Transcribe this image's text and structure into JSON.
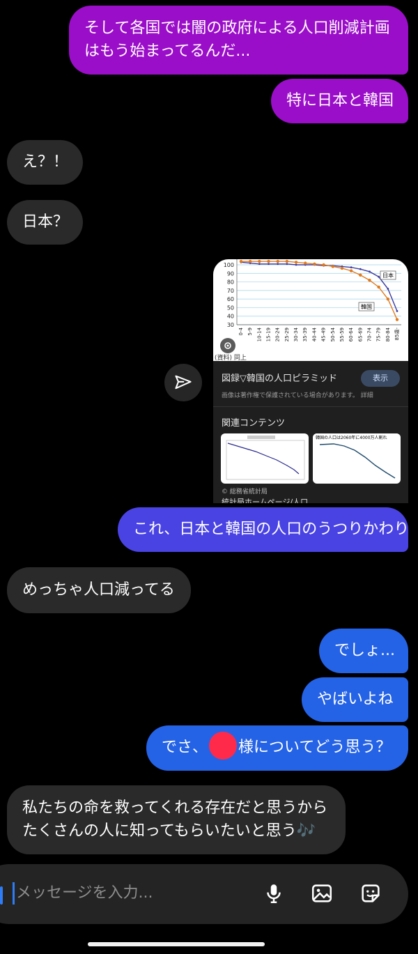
{
  "messages": {
    "m1_line1": "そして各国では闇の政府による人口削減計画",
    "m1_line2": "はもう始まってるんだ...",
    "m2": "特に日本と韓国",
    "m3": "え？！",
    "m4": "日本？",
    "m5": "これ、日本と韓国の人口のうつりかわり",
    "m6": "めっちゃ人口減ってる",
    "m7": "でしょ...",
    "m8": "やばいよね",
    "m9_before": "でさ、",
    "m9_after": "様についてどう思う？",
    "m10_line1": "私たちの命を救ってくれる存在だと思うから",
    "m10_line2": "たくさんの人に知ってもらいたいと思う🎶"
  },
  "card": {
    "title": "図録▽韓国の人口ピラミッド",
    "show_button": "表示",
    "copyright_note": "画像は著作権で保護されている場合があります。 詳細",
    "related": "関連コンテンツ",
    "source": "© 総務省統計局",
    "caption": "統計局ホームページ/人口...",
    "chart_source_label": "(資料) 同上",
    "legend_japan": "日本",
    "legend_korea": "韓国",
    "thumb2_title": "韓国の人口は2060年に4000万人割れ"
  },
  "chart_data": {
    "type": "line",
    "categories": [
      "0-4",
      "5-9",
      "10-14",
      "15-19",
      "20-24",
      "25-29",
      "30-34",
      "35-39",
      "40-44",
      "45-49",
      "50-54",
      "55-59",
      "60-64",
      "65-69",
      "70-74",
      "75-79",
      "80-84",
      "85歳-"
    ],
    "ylim": [
      30,
      100
    ],
    "yticks": [
      30,
      40,
      50,
      60,
      70,
      80,
      90,
      100
    ],
    "series": [
      {
        "name": "日本",
        "color": "#3a3aa0",
        "values": [
          103,
          102,
          101,
          101,
          101,
          101,
          100,
          100,
          100,
          99,
          99,
          98,
          97,
          95,
          92,
          86,
          72,
          46
        ]
      },
      {
        "name": "韓国",
        "color": "#e07a1f",
        "values": [
          104,
          104,
          104,
          104,
          105,
          104,
          103,
          102,
          101,
          100,
          98,
          96,
          93,
          88,
          82,
          74,
          60,
          36
        ]
      }
    ]
  },
  "composer": {
    "placeholder": "メッセージを入力..."
  }
}
